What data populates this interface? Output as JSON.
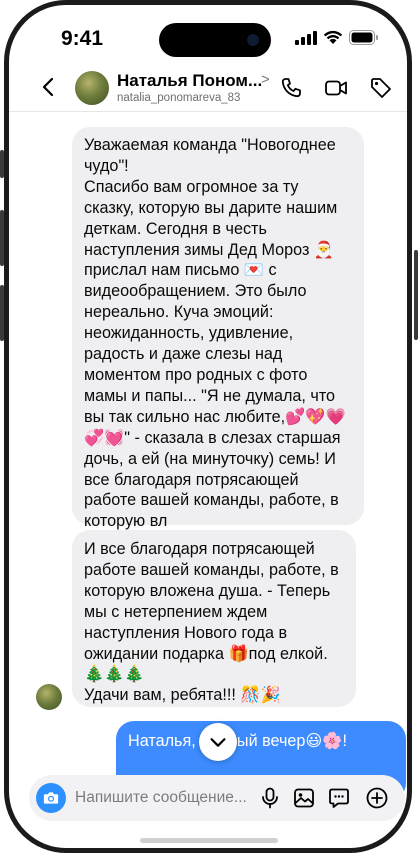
{
  "status_bar": {
    "time": "9:41"
  },
  "header": {
    "name": "Наталья Поном...",
    "chevron": ">",
    "username": "natalia_ponomareva_83",
    "icons": [
      "back-arrow-icon",
      "phone-icon",
      "video-camera-icon",
      "tag-icon"
    ]
  },
  "messages": [
    {
      "direction": "incoming",
      "text": "Уважаемая команда \"Новогоднее чудо\"!\nСпасибо вам огромное за ту сказку, которую вы дарите нашим деткам. Сегодня в честь наступления зимы Дед Мороз 🎅 прислал нам письмо 💌 с видеообращением. Это было нереально. Куча эмоций: неожиданность, удивление, радость и даже слезы над моментом про родных с фото мамы и папы... \"Я не думала, что вы так сильно нас любите,💕💖💗💞💓\" - сказала в слезах старшая дочь, а ей (на минуточку) семь! И все благодаря потрясающей работе вашей команды, работе, в которую вл"
    },
    {
      "direction": "incoming",
      "text": "И все благодаря потрясающей работе вашей команды, работе, в которую вложена душа. - Теперь мы с нетерпением ждем наступления Нового года в ожидании подарка 🎁под елкой. 🎄🎄🎄\nУдачи вам, ребята!!! 🎊🎉"
    },
    {
      "direction": "outgoing",
      "text": "Наталья, добрый вечер😃🌸!"
    }
  ],
  "composer": {
    "placeholder": "Напишите сообщение...",
    "icons": [
      "camera-icon",
      "microphone-icon",
      "gallery-icon",
      "sticker-icon",
      "plus-icon"
    ]
  },
  "colors": {
    "incoming_bubble": "#efeff1",
    "outgoing_bubble": "#3d8bff",
    "camera_button": "#2d90ff",
    "frame": "#1b1b1d"
  }
}
